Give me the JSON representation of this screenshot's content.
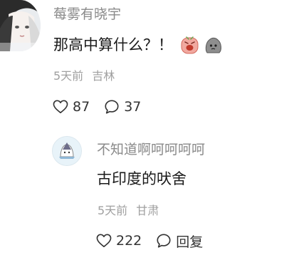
{
  "main_comment": {
    "username": "莓雾有晓宇",
    "text": "那高中算什么？！",
    "emojis": [
      "angry-face-emoji",
      "sad-rock-emoji"
    ],
    "time": "5天前",
    "location": "吉林",
    "likes": "87",
    "replies": "37",
    "avatar_icon": "anime-girl-avatar"
  },
  "reply": {
    "username": "不知道啊呵呵呵呵",
    "text": "古印度的吠舍",
    "time": "5天前",
    "location": "甘肃",
    "likes": "222",
    "reply_label": "回复",
    "avatar_icon": "cartoon-character-avatar"
  },
  "icons": {
    "like": "heart-outline-icon",
    "comment": "speech-bubble-icon"
  },
  "colors": {
    "username": "#8a8a8a",
    "meta": "#a0a0a0",
    "text": "#1a1a1a"
  }
}
